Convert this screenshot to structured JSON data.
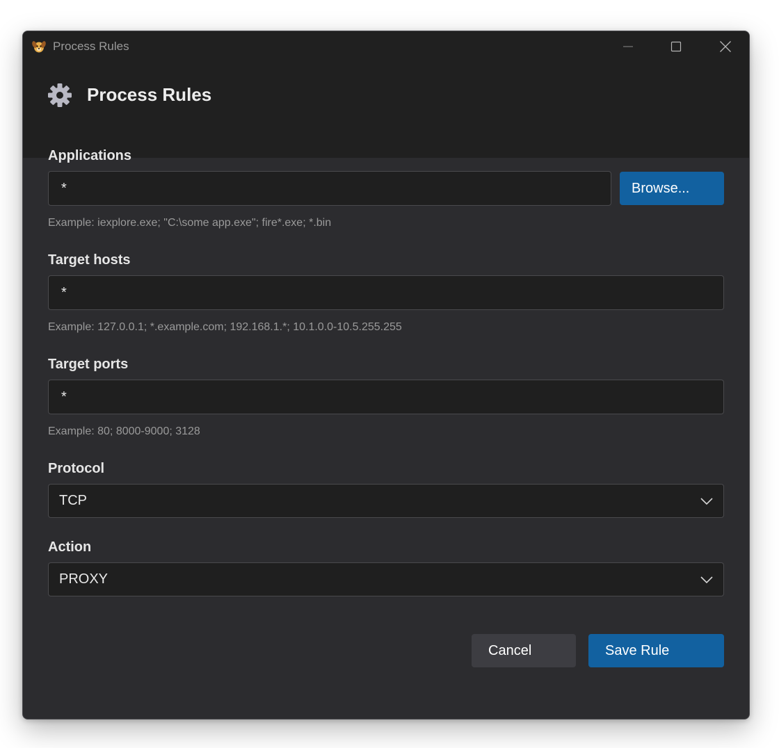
{
  "window": {
    "title": "Process Rules"
  },
  "header": {
    "title": "Process Rules"
  },
  "form": {
    "applications": {
      "label": "Applications",
      "value": "*",
      "hint": "Example: iexplore.exe; \"C:\\some app.exe\"; fire*.exe; *.bin",
      "browse_label": "Browse..."
    },
    "target_hosts": {
      "label": "Target hosts",
      "value": "*",
      "hint": "Example: 127.0.0.1; *.example.com; 192.168.1.*; 10.1.0.0-10.5.255.255"
    },
    "target_ports": {
      "label": "Target ports",
      "value": "*",
      "hint": "Example: 80; 8000-9000; 3128"
    },
    "protocol": {
      "label": "Protocol",
      "selected": "TCP"
    },
    "action": {
      "label": "Action",
      "selected": "PROXY"
    }
  },
  "buttons": {
    "cancel": "Cancel",
    "save": "Save Rule"
  },
  "icons": {
    "app": "dog-face-icon",
    "header": "gear-icon",
    "minimize": "minimize-icon",
    "maximize": "maximize-icon",
    "close": "close-icon",
    "dropdown": "chevron-down-icon"
  },
  "colors": {
    "accent": "#1261a0",
    "background": "#2c2c2f",
    "header_background": "#202020"
  }
}
